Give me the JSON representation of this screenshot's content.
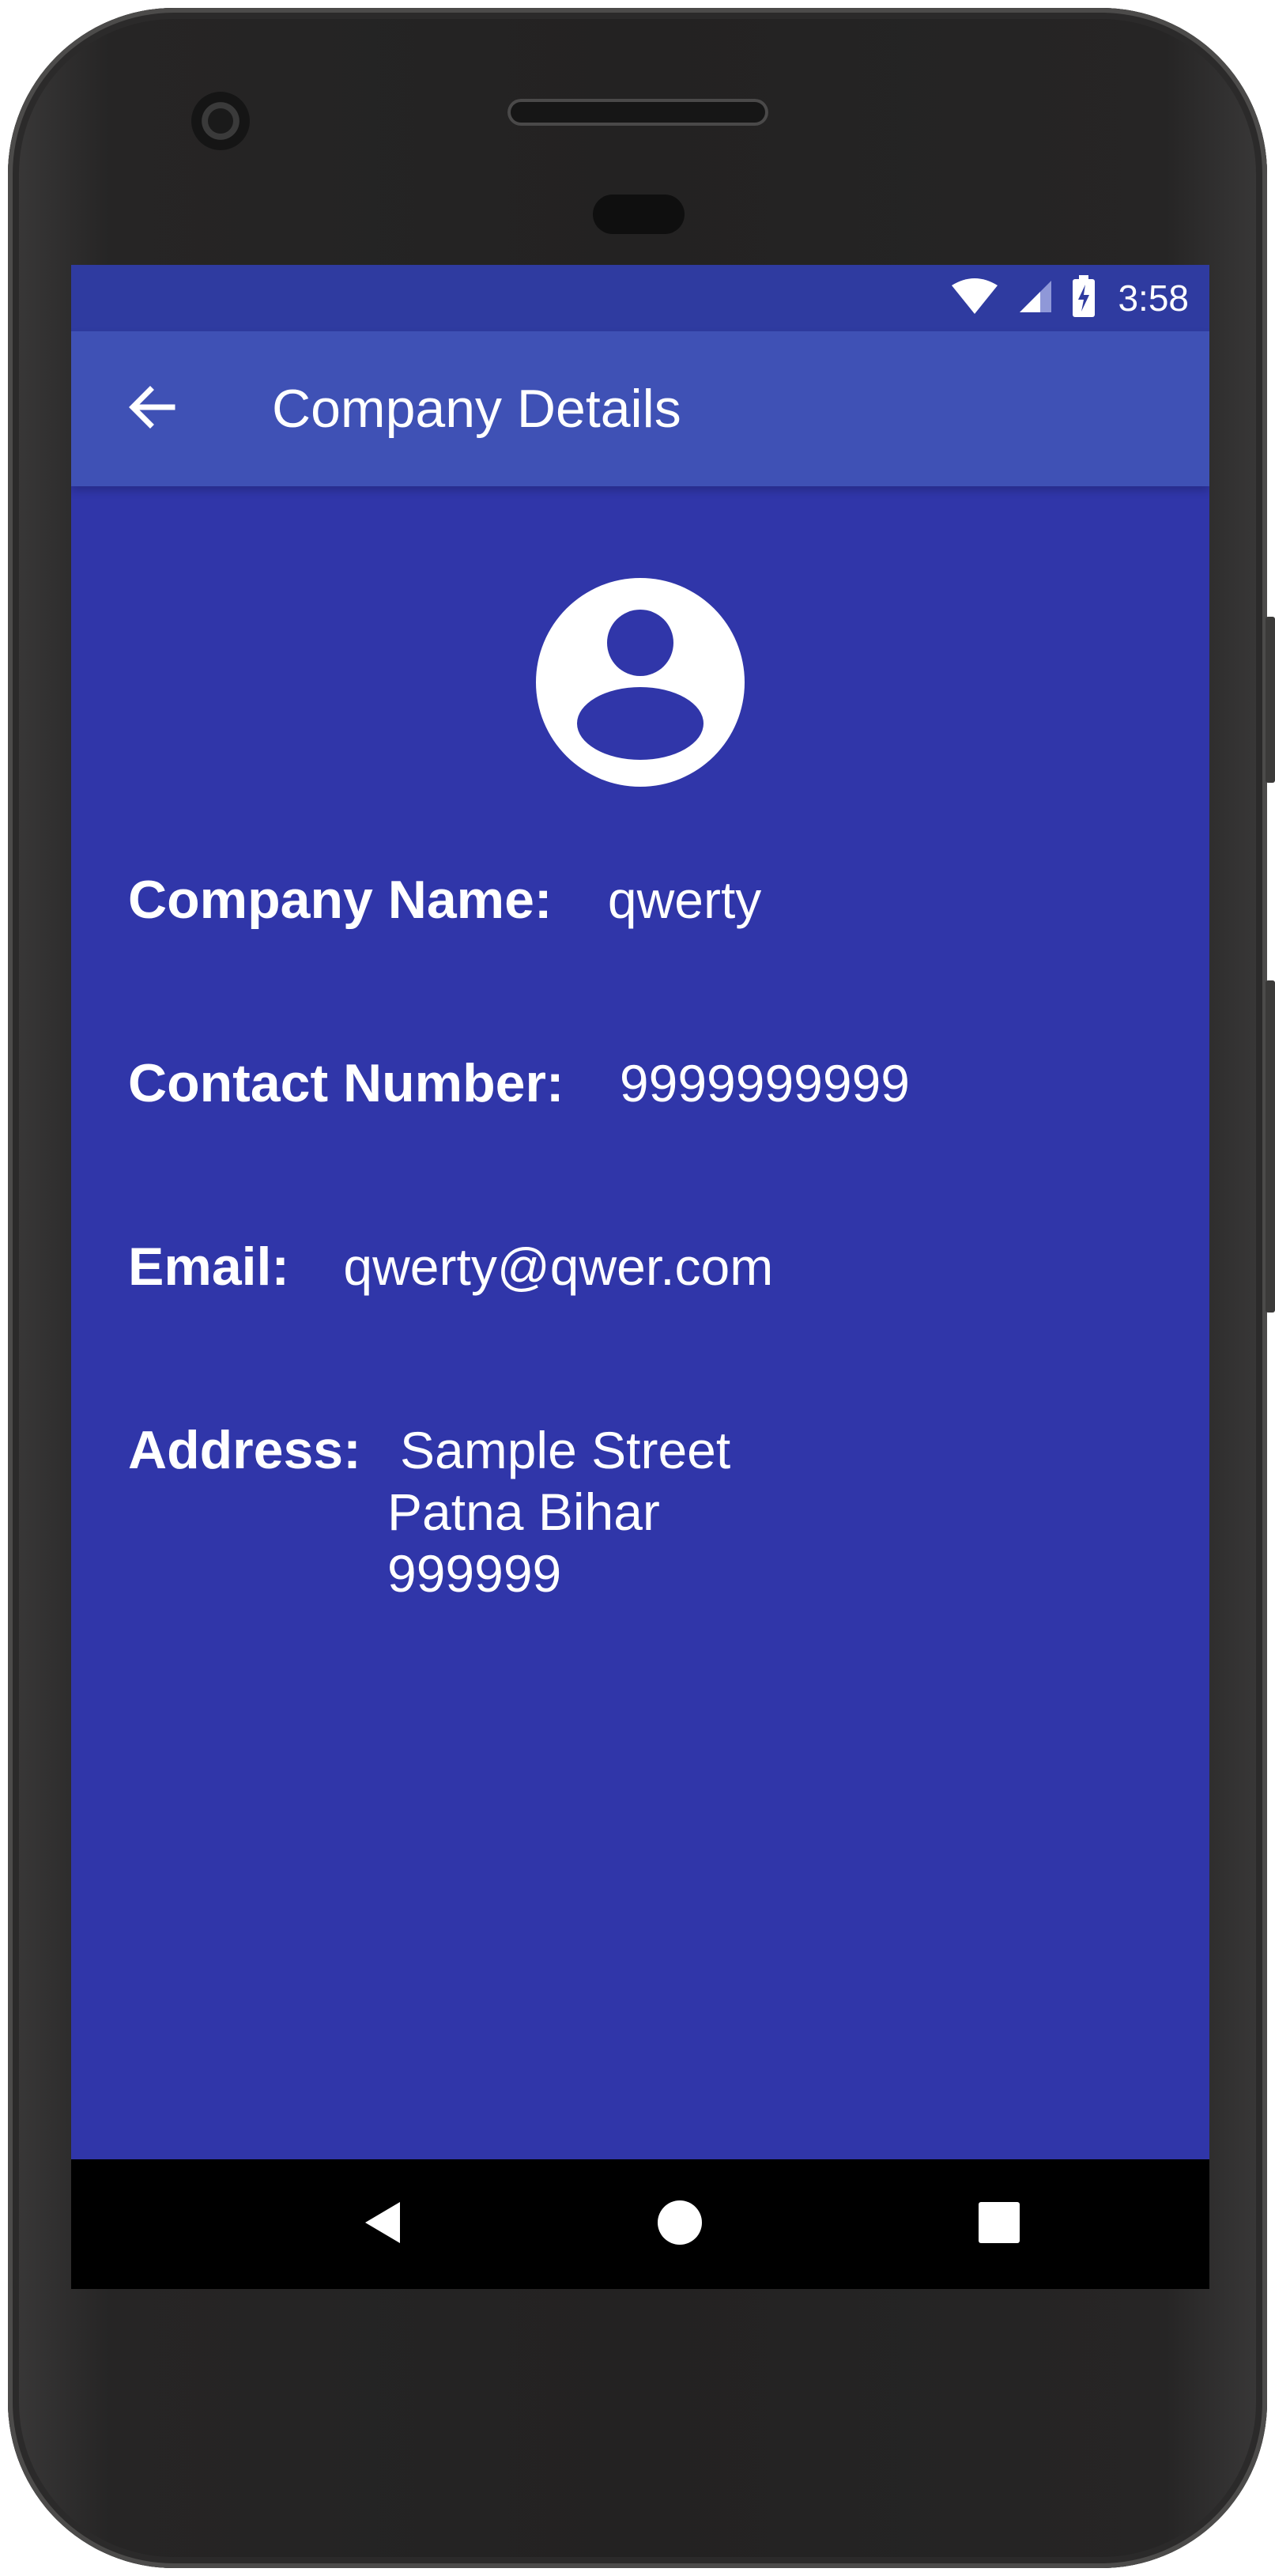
{
  "status_bar": {
    "time": "3:58",
    "icons": [
      "wifi-icon",
      "cell-signal-icon",
      "battery-charging-icon"
    ]
  },
  "app_bar": {
    "title": "Company Details",
    "back_icon": "arrow-left-icon"
  },
  "profile": {
    "avatar_icon": "account-circle-icon"
  },
  "details": {
    "company_name_label": "Company Name:",
    "company_name_value": "qwerty",
    "contact_label": "Contact Number:",
    "contact_value": "9999999999",
    "email_label": "Email:",
    "email_value": "qwerty@qwer.com",
    "address_label": "Address:",
    "address_lines": [
      "Sample Street",
      "Patna Bihar",
      "999999"
    ]
  },
  "nav_bar": {
    "icons": [
      "nav-back-icon",
      "nav-home-icon",
      "nav-recents-icon"
    ]
  },
  "colors": {
    "background": "#3036a9",
    "app_bar": "#3f51b5",
    "status_bar": "#2f3ba0",
    "text": "#ffffff",
    "nav_bar": "#000000"
  }
}
